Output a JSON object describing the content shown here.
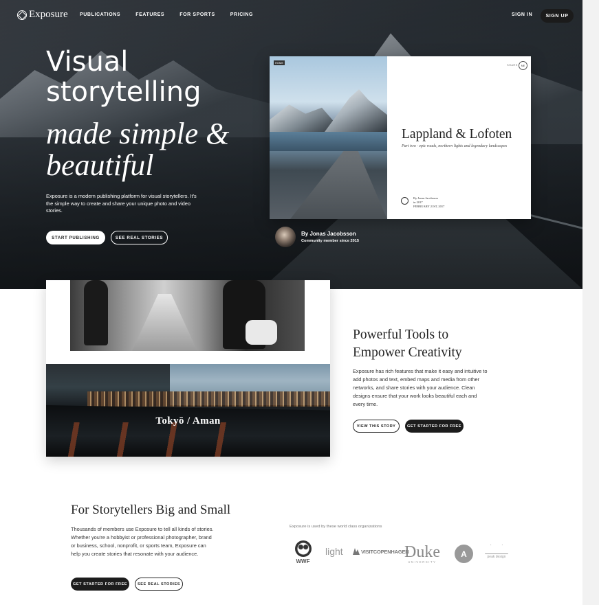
{
  "nav": {
    "logo_text": "Exposure",
    "links": [
      "PUBLICATIONS",
      "FEATURES",
      "FOR SPORTS",
      "PRICING"
    ],
    "sign_in": "SIGN IN",
    "sign_up": "SIGN UP"
  },
  "hero": {
    "headline_line1": "Visual",
    "headline_line2": "storytelling",
    "headline_italic_line1": "made simple &",
    "headline_italic_line2": "beautiful",
    "description": "Exposure is a modern publishing platform for visual storytellers. It's the simple way to create and share your unique photo and video stories.",
    "start_button": "START PUBLISHING",
    "real_button": "SEE REAL STORIES"
  },
  "story_card": {
    "tag": "HOME",
    "share": "SHARE",
    "badge": "NE",
    "title": "Lappland & Lofoten",
    "subtitle": "Part two · epic roads, northern lights and legendary landscapes",
    "byline_author": "By Jonas Jacobsson",
    "byline_meta": "in 2017",
    "byline_date": "FEBRUARY 21ST, 2017"
  },
  "author": {
    "name": "By Jonas Jacobsson",
    "since": "Community member since 2015"
  },
  "section2": {
    "story_label": "Tokyō / Aman",
    "title_line1": "Powerful Tools to",
    "title_line2": "Empower Creativity",
    "description": "Exposure has rich features that make it easy and intuitive to add photos and text, embed maps and media from other networks, and share stories with your audience. Clean designs ensure that your work looks beautiful each and every time.",
    "view_button": "VIEW THIS STORY",
    "start_button": "GET STARTED FOR FREE"
  },
  "section3": {
    "title": "For Storytellers Big and Small",
    "description": "Thousands of members use Exposure to tell all kinds of stories. Whether you're a hobbyist or professional photographer, brand or business, school, nonprofit, or sports team, Exposure can help you create stories that resonate with your audience.",
    "start_button": "GET STARTED FOR FREE",
    "real_button": "SEE REAL STORIES",
    "orgs_caption": "Exposure is used by these world class organizations",
    "orgs": {
      "wwf": "WWF",
      "light": "light",
      "visitcph": "VISITCOPENHAGEN",
      "duke": "Duke",
      "duke_sub": "UNIVERSITY",
      "a": "A",
      "peak": "peak design"
    }
  }
}
